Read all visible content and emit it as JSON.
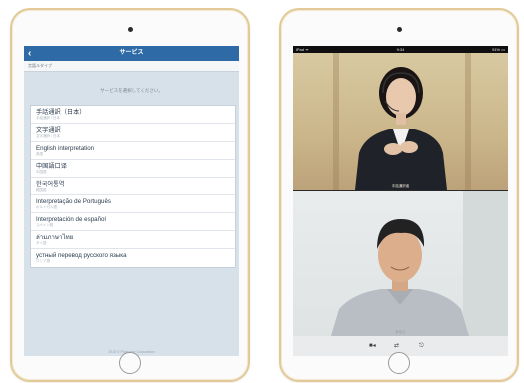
{
  "left_tablet": {
    "nav": {
      "back_icon": "chevron-left-icon",
      "title": "サービス"
    },
    "sub_bar": "言語ルタイプ",
    "prompt": "サービスを選択してください。",
    "services": [
      {
        "title": "手話通訳（日本）",
        "subtitle": "手話通訳 / 日本"
      },
      {
        "title": "文字通訳",
        "subtitle": "文字通訳 / 日本"
      },
      {
        "title": "English interpretation",
        "subtitle": "英語"
      },
      {
        "title": "中国語口译",
        "subtitle": "中国語"
      },
      {
        "title": "한국어통역",
        "subtitle": "韓国語"
      },
      {
        "title": "Interpretação de Português",
        "subtitle": "ポルトガル語"
      },
      {
        "title": "Interpretación de español",
        "subtitle": "スペイン語"
      },
      {
        "title": "ล่ามภาษาไทย",
        "subtitle": "タイ語"
      },
      {
        "title": "устный перевод русского языка",
        "subtitle": "ロシア語"
      }
    ],
    "footer": "2015 © Plusvoice Corporation"
  },
  "right_tablet": {
    "status": {
      "left": "iPad ᯤ",
      "time": "9:34",
      "right": "91% ▭"
    },
    "video_top_caption": "手話通訳者",
    "video_bottom_caption": "あなた",
    "controls": [
      {
        "icon": "camera-icon",
        "glyph": "■◂"
      },
      {
        "icon": "switch-camera-icon",
        "glyph": "⇄"
      },
      {
        "icon": "end-call-icon",
        "glyph": "⎋"
      }
    ]
  }
}
